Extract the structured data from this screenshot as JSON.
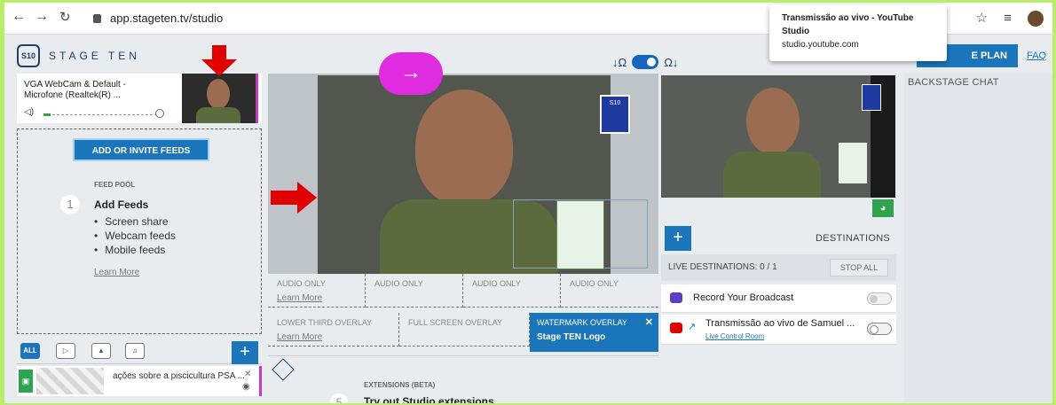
{
  "browser": {
    "url": "app.stageten.tv/studio",
    "tooltip_title": "Transmissão ao vivo - YouTube Studio",
    "tooltip_domain": "studio.youtube.com"
  },
  "header": {
    "brand": "STAGE TEN",
    "plan_button": "E PLAN",
    "faq": "FAQ"
  },
  "source": {
    "label": "VGA WebCam & Default - Microfone (Realtek(R) ..."
  },
  "feed_pool": {
    "add_button": "ADD OR INVITE FEEDS",
    "section_title": "FEED POOL",
    "step_number": "1",
    "step_title": "Add Feeds",
    "items": [
      "Screen share",
      "Webcam feeds",
      "Mobile feeds"
    ],
    "learn_more": "Learn More"
  },
  "media_tabs": {
    "all": "ALL"
  },
  "media": {
    "item_label": "ações sobre a piscicultura PSA ..."
  },
  "overlays": {
    "audio_only": "AUDIO ONLY",
    "learn_more": "Learn More",
    "lower_third": "LOWER THIRD OVERLAY",
    "full_screen": "FULL SCREEN OVERLAY",
    "watermark": "WATERMARK OVERLAY",
    "watermark_name": "Stage TEN Logo"
  },
  "extensions": {
    "title": "EXTENSIONS (BETA)",
    "step_number": "5",
    "step_title": "Try out Studio extensions"
  },
  "destinations": {
    "title": "DESTINATIONS",
    "live_count": "LIVE DESTINATIONS: 0 / 1",
    "stop_all": "STOP ALL",
    "record": "Record Your Broadcast",
    "youtube": "Transmissão ao vivo de Samuel ...",
    "live_control": "Live Control Room"
  },
  "chat": {
    "title": "BACKSTAGE CHAT"
  },
  "colors": {
    "accent": "#1b75bb",
    "annotation_arrow": "#e00000",
    "pink_arrow": "#e02ce0",
    "frame_border": "#b9ee6a"
  }
}
